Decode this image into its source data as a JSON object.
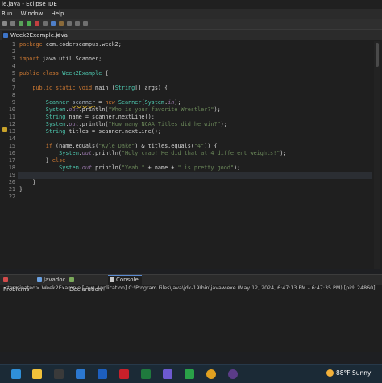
{
  "window": {
    "title": "le.java - Eclipse IDE"
  },
  "menu": {
    "items": [
      "Run",
      "Window",
      "Help"
    ]
  },
  "editor": {
    "tab_label": "Week2Example.java",
    "tab_close": "✕",
    "lines": [
      {
        "n": "1",
        "t": "package com.coderscampus.week2;"
      },
      {
        "n": "2",
        "t": ""
      },
      {
        "n": "3",
        "t": "import java.util.Scanner;"
      },
      {
        "n": "4",
        "t": ""
      },
      {
        "n": "5",
        "t": "public class Week2Example {"
      },
      {
        "n": "6",
        "t": ""
      },
      {
        "n": "7",
        "t": "    public static void main (String[] args) {"
      },
      {
        "n": "8",
        "t": ""
      },
      {
        "n": "9",
        "t": "        Scanner scanner = new Scanner(System.in);"
      },
      {
        "n": "10",
        "t": "        System.out.println(\"Who is your favorite Wrestler?\");"
      },
      {
        "n": "11",
        "t": "        String name = scanner.nextLine();"
      },
      {
        "n": "12",
        "t": "        System.out.println(\"How many NCAA Titles did he win?\");"
      },
      {
        "n": "13",
        "t": "        String titles = scanner.nextLine();"
      },
      {
        "n": "14",
        "t": ""
      },
      {
        "n": "15",
        "t": "        if (name.equals(\"Kyle Dake\") & titles.equals(\"4\")) {"
      },
      {
        "n": "16",
        "t": "            System.out.println(\"Holy crap! He did that at 4 different weights!\");"
      },
      {
        "n": "17",
        "t": "        } else"
      },
      {
        "n": "18",
        "t": "            System.out.println(\"Yeah \" + name + \" is pretty good\");"
      },
      {
        "n": "19",
        "t": ""
      },
      {
        "n": "20",
        "t": "    }"
      },
      {
        "n": "21",
        "t": "}"
      },
      {
        "n": "22",
        "t": ""
      }
    ]
  },
  "views": {
    "tabs": [
      {
        "label": "Problems",
        "color": "#d24b4b"
      },
      {
        "label": "Javadoc",
        "color": "#6aa0e0"
      },
      {
        "label": "Declaration",
        "color": "#7aa85a"
      },
      {
        "label": "Console",
        "color": "#c8c8c8",
        "active": true
      }
    ],
    "console_text": "<terminated> Week2Example [Java Application] C:\\Program Files\\Java\\jdk-19\\bin\\javaw.exe  (May 12, 2024, 6:47:13 PM – 6:47:35 PM) [pid: 24860]"
  },
  "taskbar": {
    "icons": [
      {
        "name": "edge-icon",
        "color": "#2f8fd8"
      },
      {
        "name": "file-explorer-icon",
        "color": "#f2c23a"
      },
      {
        "name": "media-icon",
        "color": "#3a3a3a"
      },
      {
        "name": "mail-icon",
        "color": "#2b78d0"
      },
      {
        "name": "l-app-icon",
        "color": "#1d5fbf"
      },
      {
        "name": "mcafee-icon",
        "color": "#c8202a"
      },
      {
        "name": "excel-icon",
        "color": "#1f7a3d"
      },
      {
        "name": "photos-icon",
        "color": "#6d5ad0"
      },
      {
        "name": "xbox-icon",
        "color": "#2aa148"
      },
      {
        "name": "chrome-icon",
        "color": "#e0a020"
      },
      {
        "name": "eclipse-icon",
        "color": "#5b3c88"
      }
    ],
    "weather": "88°F  Sunny"
  }
}
